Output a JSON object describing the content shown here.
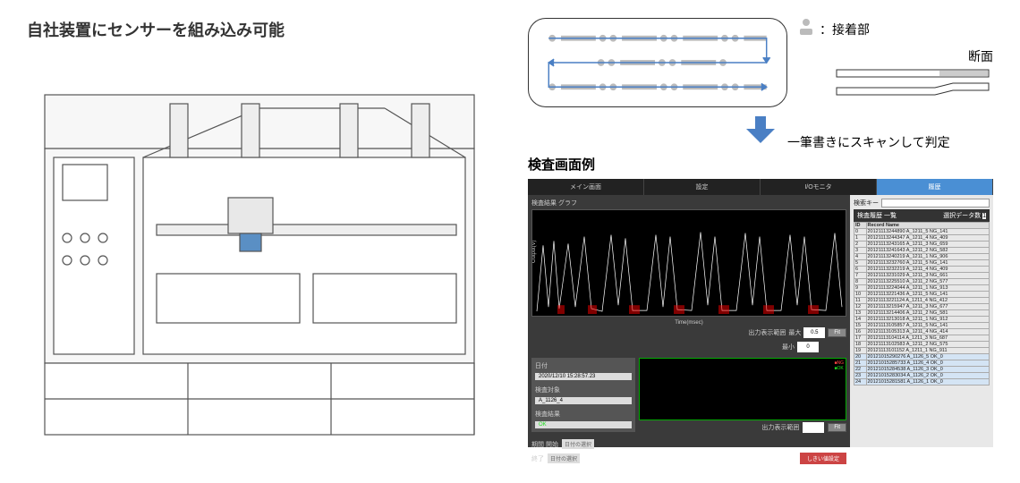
{
  "heading_left": "自社装置にセンサーを組み込み可能",
  "legend_label": "：接着部",
  "cross_section_label": "断面",
  "scan_caption": "一筆書きにスキャンして判定",
  "sub_heading": "検査画面例",
  "tabs": [
    "メイン画面",
    "設定",
    "I/Oモニタ",
    "履歴"
  ],
  "graph_section_title": "検査結果 グラフ",
  "graph_xlabel": "Time(msec)",
  "graph_ylabel": "Output(V)",
  "graph_range_label": "出力表示範囲",
  "graph_range_max_label": "最大",
  "graph_range_min_label": "最小",
  "graph_max_val": "0.5",
  "graph_min_val": "0",
  "fit_button": "Fit",
  "info": {
    "date_label": "日付",
    "date_value": "2020/12/10 15:28:57.23",
    "target_label": "検査対象",
    "target_value": "A_1126_4",
    "result_label": "検査結果",
    "result_value": "OK"
  },
  "ng_label": "NG",
  "ok_label": "OK",
  "period_start_label": "期間 開始",
  "period_end_label": "終了",
  "date_unselected": "日付の選択",
  "output_range_label": "出力表示範囲",
  "threshold_button": "しきい値設定",
  "search_key_label": "検索キー",
  "history_title": "検査履歴 一覧",
  "data_count_label": "選択データ数",
  "data_count": "1",
  "table_headers": [
    "ID",
    "Record Name"
  ],
  "table_rows": [
    [
      "0",
      "20121113244890 A_1211_5  NG_141"
    ],
    [
      "1",
      "20121113244347 A_1211_4  NG_409"
    ],
    [
      "2",
      "20121113243165 A_1211_3  NG_659"
    ],
    [
      "3",
      "20121113241643 A_1211_2  NG_582"
    ],
    [
      "4",
      "20121113240219 A_1211_1  NG_906"
    ],
    [
      "5",
      "20121113232760 A_1211_5  NG_141"
    ],
    [
      "6",
      "20121113232219 A_1211_4  NG_409"
    ],
    [
      "7",
      "20121113231029 A_1211_3  NG_661"
    ],
    [
      "8",
      "20121113225510 A_1211_2  NG_577"
    ],
    [
      "9",
      "20121113224044 A_1211_1  NG_913"
    ],
    [
      "10",
      "20121113221436 A_1211_5  NG_141"
    ],
    [
      "11",
      "20121113221124 A_1211_4  NG_412"
    ],
    [
      "12",
      "20121113215947 A_1211_3  NG_677"
    ],
    [
      "13",
      "20121113214406 A_1211_2  NG_581"
    ],
    [
      "14",
      "20121113213018 A_1211_1  NG_912"
    ],
    [
      "15",
      "20121113105857 A_1211_5  NG_141"
    ],
    [
      "16",
      "20121113105313 A_1211_4  NG_414"
    ],
    [
      "17",
      "20121113104114 A_1211_3  NG_687"
    ],
    [
      "18",
      "20121113102583 A_1211_2  NG_575"
    ],
    [
      "19",
      "20121113101152 A_1211_1  NG_911"
    ],
    [
      "20",
      "20121015290276 A_1126_5  OK_0"
    ],
    [
      "21",
      "20121015285733 A_1126_4  OK_0"
    ],
    [
      "22",
      "20121015284538 A_1126_3  OK_0"
    ],
    [
      "23",
      "20121015283034 A_1126_2  OK_0"
    ],
    [
      "24",
      "20121015281581 A_1126_1  OK_0"
    ]
  ],
  "chart_data": {
    "type": "line",
    "title": "検査結果 グラフ",
    "xlabel": "Time(msec)",
    "ylabel": "Output(V)",
    "ylim": [
      0,
      0.5
    ],
    "xlim": [
      0,
      5000
    ],
    "xticks": [
      0,
      1000,
      2000,
      3000,
      4000,
      5000
    ],
    "yticks": [
      0,
      0.1,
      0.2,
      0.3,
      0.4,
      0.5
    ],
    "series": [
      {
        "name": "Output",
        "description": "Noisy signal with approx. 10 peak clusters between 0 and 5000 msec, peaks reaching ~0.35–0.45 V, baseline near 0.02 V, red NG regions highlighted under several troughs"
      }
    ]
  }
}
